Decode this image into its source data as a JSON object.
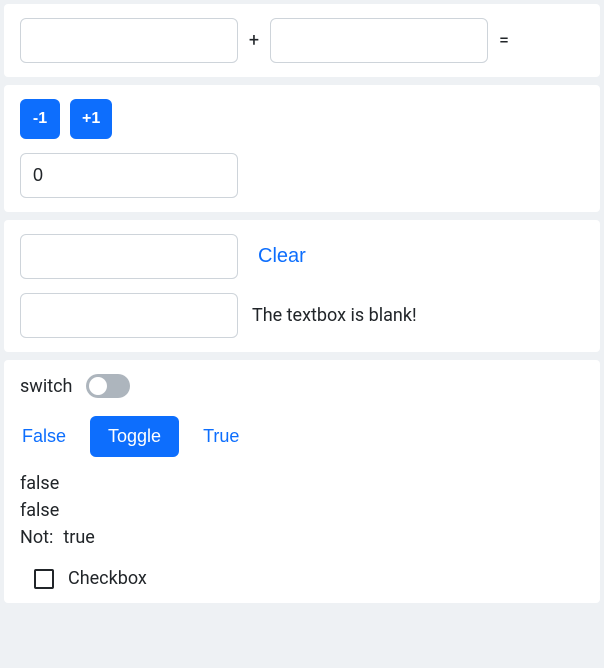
{
  "addition": {
    "a_value": "",
    "b_value": "",
    "plus_symbol": "+",
    "equals_symbol": "=",
    "result": ""
  },
  "counter": {
    "dec_label": "-1",
    "inc_label": "+1",
    "value": "0"
  },
  "textbox": {
    "value_upper": "",
    "clear_label": "Clear",
    "value_lower": "",
    "status": "The textbox is blank!"
  },
  "toggle": {
    "switch_label": "switch",
    "switch_on": false,
    "false_btn": "False",
    "toggle_btn": "Toggle",
    "true_btn": "True",
    "value1": "false",
    "value2": "false",
    "not_label": "Not:",
    "not_value": "true",
    "checkbox_label": "Checkbox",
    "checkbox_checked": false
  }
}
